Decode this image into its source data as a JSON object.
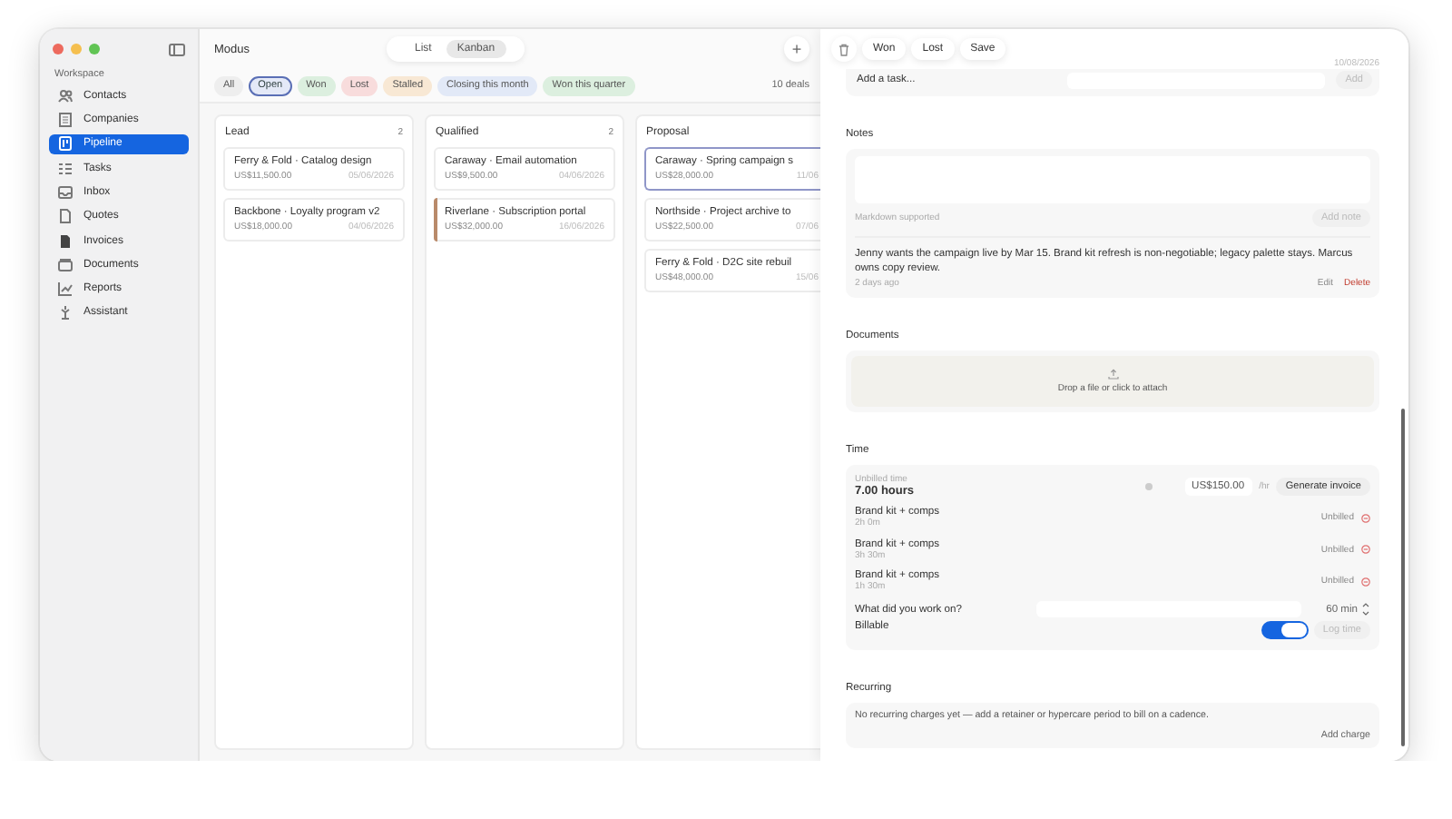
{
  "app": {
    "title": "Modus"
  },
  "sidebar": {
    "section": "Workspace",
    "items": [
      {
        "label": "Contacts",
        "selected": false
      },
      {
        "label": "Companies",
        "selected": false
      },
      {
        "label": "Pipeline",
        "selected": true
      },
      {
        "label": "Tasks",
        "selected": false
      },
      {
        "label": "Inbox",
        "selected": false
      },
      {
        "label": "Quotes",
        "selected": false
      },
      {
        "label": "Invoices",
        "selected": false
      },
      {
        "label": "Documents",
        "selected": false
      },
      {
        "label": "Reports",
        "selected": false
      },
      {
        "label": "Assistant",
        "selected": false
      }
    ]
  },
  "view_toggle": [
    {
      "label": "List",
      "selected": false
    },
    {
      "label": "Kanban",
      "selected": true
    }
  ],
  "add_button": "+",
  "filters": [
    {
      "label": "All",
      "selected": false,
      "color": "#eeeeee"
    },
    {
      "label": "Open",
      "selected": true,
      "color": "#e4e9f7"
    },
    {
      "label": "Won",
      "selected": false,
      "color": "#dcefdf"
    },
    {
      "label": "Lost",
      "selected": false,
      "color": "#f8dcdc"
    },
    {
      "label": "Stalled",
      "selected": false,
      "color": "#f8e8d4"
    },
    {
      "label": "Closing this month",
      "selected": false,
      "color": "#e2e9f7"
    },
    {
      "label": "Won this quarter",
      "selected": false,
      "color": "#dcefdf"
    }
  ],
  "deal_count": "10 deals",
  "columns": [
    {
      "title": "Lead",
      "count": "2",
      "cards": [
        {
          "title": "Ferry & Fold · Catalog design",
          "amount": "US$11,500.00",
          "date": "05/06/2026",
          "selected": false
        },
        {
          "title": "Backbone · Loyalty program v2",
          "amount": "US$18,000.00",
          "date": "04/06/2026",
          "selected": false
        }
      ]
    },
    {
      "title": "Qualified",
      "count": "2",
      "cards": [
        {
          "title": "Caraway · Email automation",
          "amount": "US$9,500.00",
          "date": "04/06/2026",
          "selected": false
        },
        {
          "title": "Riverlane · Subscription portal",
          "amount": "US$32,000.00",
          "date": "16/06/2026",
          "selected": false,
          "color": "#b98a6a"
        }
      ]
    },
    {
      "title": "Proposal",
      "cards": [
        {
          "title": "Caraway · Spring campaign s",
          "amount": "US$28,000.00",
          "date": "11/06",
          "selected": true
        },
        {
          "title": "Northside · Project archive to",
          "amount": "US$22,500.00",
          "date": "07/06",
          "selected": false
        },
        {
          "title": "Ferry & Fold · D2C site rebuil",
          "amount": "US$48,000.00",
          "date": "15/06",
          "selected": false
        }
      ]
    }
  ],
  "toolbar": {
    "buttons": [
      "Won",
      "Lost",
      "Save"
    ]
  },
  "tasks": {
    "date": "10/08/2026",
    "placeholder": "Add a task...",
    "add": {
      "label": "Add",
      "disabled": true
    }
  },
  "notes": {
    "title": "Notes",
    "hint": "Markdown supported",
    "add": {
      "label": "Add note",
      "disabled": true
    },
    "items": [
      {
        "text": "Jenny wants the campaign live by Mar 15. Brand kit refresh is non-negotiable; legacy palette stays. Marcus owns copy review.",
        "time": "2 days ago",
        "edit": "Edit",
        "delete": "Delete"
      }
    ]
  },
  "documents": {
    "title": "Documents",
    "drop": "Drop a file or click to attach"
  },
  "time": {
    "title": "Time",
    "unbilled_label": "Unbilled time",
    "hours": "7.00 hours",
    "rate": "US$150.00",
    "unit": "/hr",
    "generate": {
      "label": "Generate invoice",
      "disabled": false
    },
    "entries": [
      {
        "name": "Brand kit + comps",
        "duration": "2h 0m",
        "status": "Unbilled"
      },
      {
        "name": "Brand kit + comps",
        "duration": "3h 30m",
        "status": "Unbilled"
      },
      {
        "name": "Brand kit + comps",
        "duration": "1h 30m",
        "status": "Unbilled"
      }
    ],
    "work_label": "What did you work on?",
    "minutes": "60 min",
    "billable": {
      "label": "Billable",
      "on": true
    },
    "log": {
      "label": "Log time",
      "disabled": true
    }
  },
  "recurring": {
    "title": "Recurring",
    "empty": "No recurring charges yet — add a retainer or hypercare period to bill on a cadence.",
    "add": "Add charge"
  }
}
